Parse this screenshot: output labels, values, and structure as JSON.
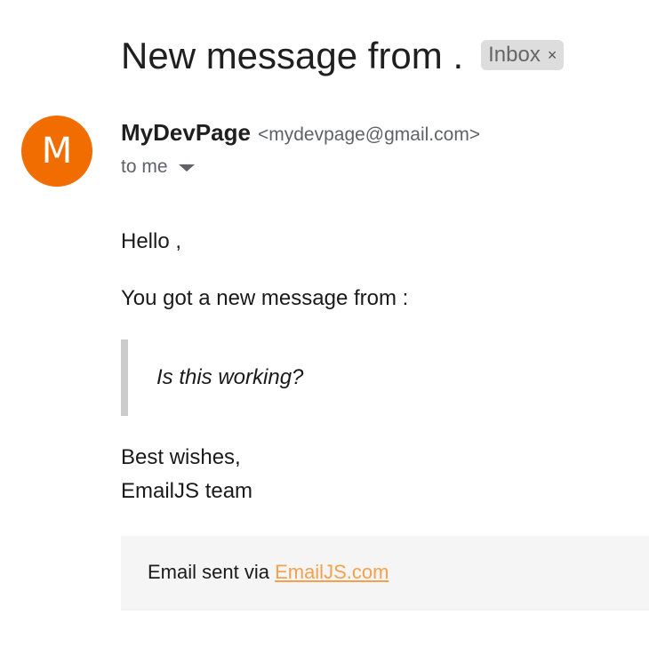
{
  "email": {
    "subject": "New message from .",
    "label": "Inbox",
    "label_close": "×",
    "sender": {
      "avatar_letter": "M",
      "avatar_color": "#f16d01",
      "name": "MyDevPage",
      "email": "<mydevpage@gmail.com>"
    },
    "recipient": "to me",
    "body": {
      "greeting": "Hello ,",
      "intro": "You got a new message from :",
      "quote": "Is this working?",
      "closing_1": "Best wishes,",
      "closing_2": "EmailJS team"
    },
    "footer": {
      "prefix": "Email sent via ",
      "link_text": "EmailJS.com",
      "link_color": "#f6a04d"
    }
  }
}
